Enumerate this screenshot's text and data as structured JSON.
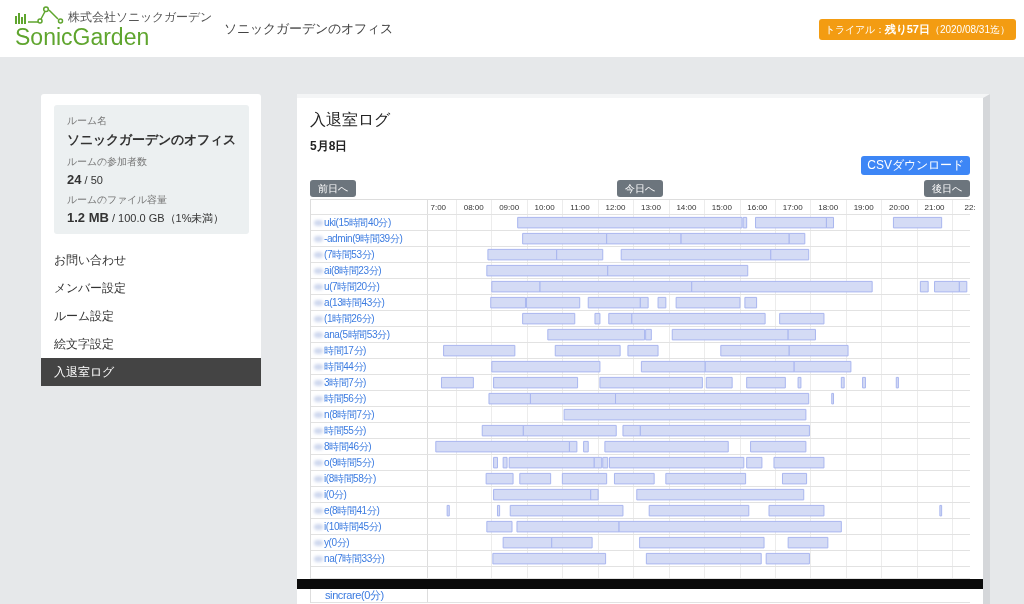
{
  "header": {
    "logo": {
      "company": "株式会社ソニックガーデン",
      "name": "SonicGarden"
    },
    "title": "ソニックガーデンのオフィス",
    "trial_badge": "トライアル：**残り57日**（2020/08/31迄）"
  },
  "sidebar": {
    "info": [
      {
        "label": "ルーム名",
        "value": "**ソニックガーデンのオフィス**"
      },
      {
        "label": "ルームの参加者数",
        "value": "**24** / 50"
      },
      {
        "label": "ルームのファイル容量",
        "value": "**1.2 MB** / 100.0 GB（1%未満）"
      }
    ],
    "items": [
      {
        "label": "お問い合わせ",
        "selected": false
      },
      {
        "label": "メンバー設定",
        "selected": false
      },
      {
        "label": "ルーム設定",
        "selected": false
      },
      {
        "label": "絵文字設定",
        "selected": false
      },
      {
        "label": "入退室ログ",
        "selected": true
      }
    ]
  },
  "main": {
    "title": "入退室ログ",
    "date": "5月8日",
    "csv_button": "CSVダウンロード",
    "prev_button": "前日へ",
    "today_button": "今日へ",
    "next_button": "後日へ",
    "timeline": {
      "hours": [
        "7:00",
        "08:00",
        "09:00",
        "10:00",
        "11:00",
        "12:00",
        "13:00",
        "14:00",
        "15:00",
        "16:00",
        "17:00",
        "18:00",
        "19:00",
        "20:00",
        "21:00",
        "22:"
      ],
      "members": [
        "uki(15時間40分)",
        "-admin(9時間39分)",
        "(7時間53分)",
        "ai(8時間23分)",
        "u(7時間20分)",
        "a(13時間43分)",
        "(1時間26分)",
        "ana(5時間53分)",
        "時間17分)",
        "時間44分)",
        "3時間7分)",
        "時間56分)",
        "n(8時間7分)",
        "時間55分)",
        "8時間46分)",
        "o(9時間5分)",
        "i(8時間58分)",
        "i(0分)",
        "e(8時間41分)",
        "i(10時間45分)",
        "y(0分)",
        "na(7時間33分)",
        "sincrare(0分)"
      ]
    }
  }
}
